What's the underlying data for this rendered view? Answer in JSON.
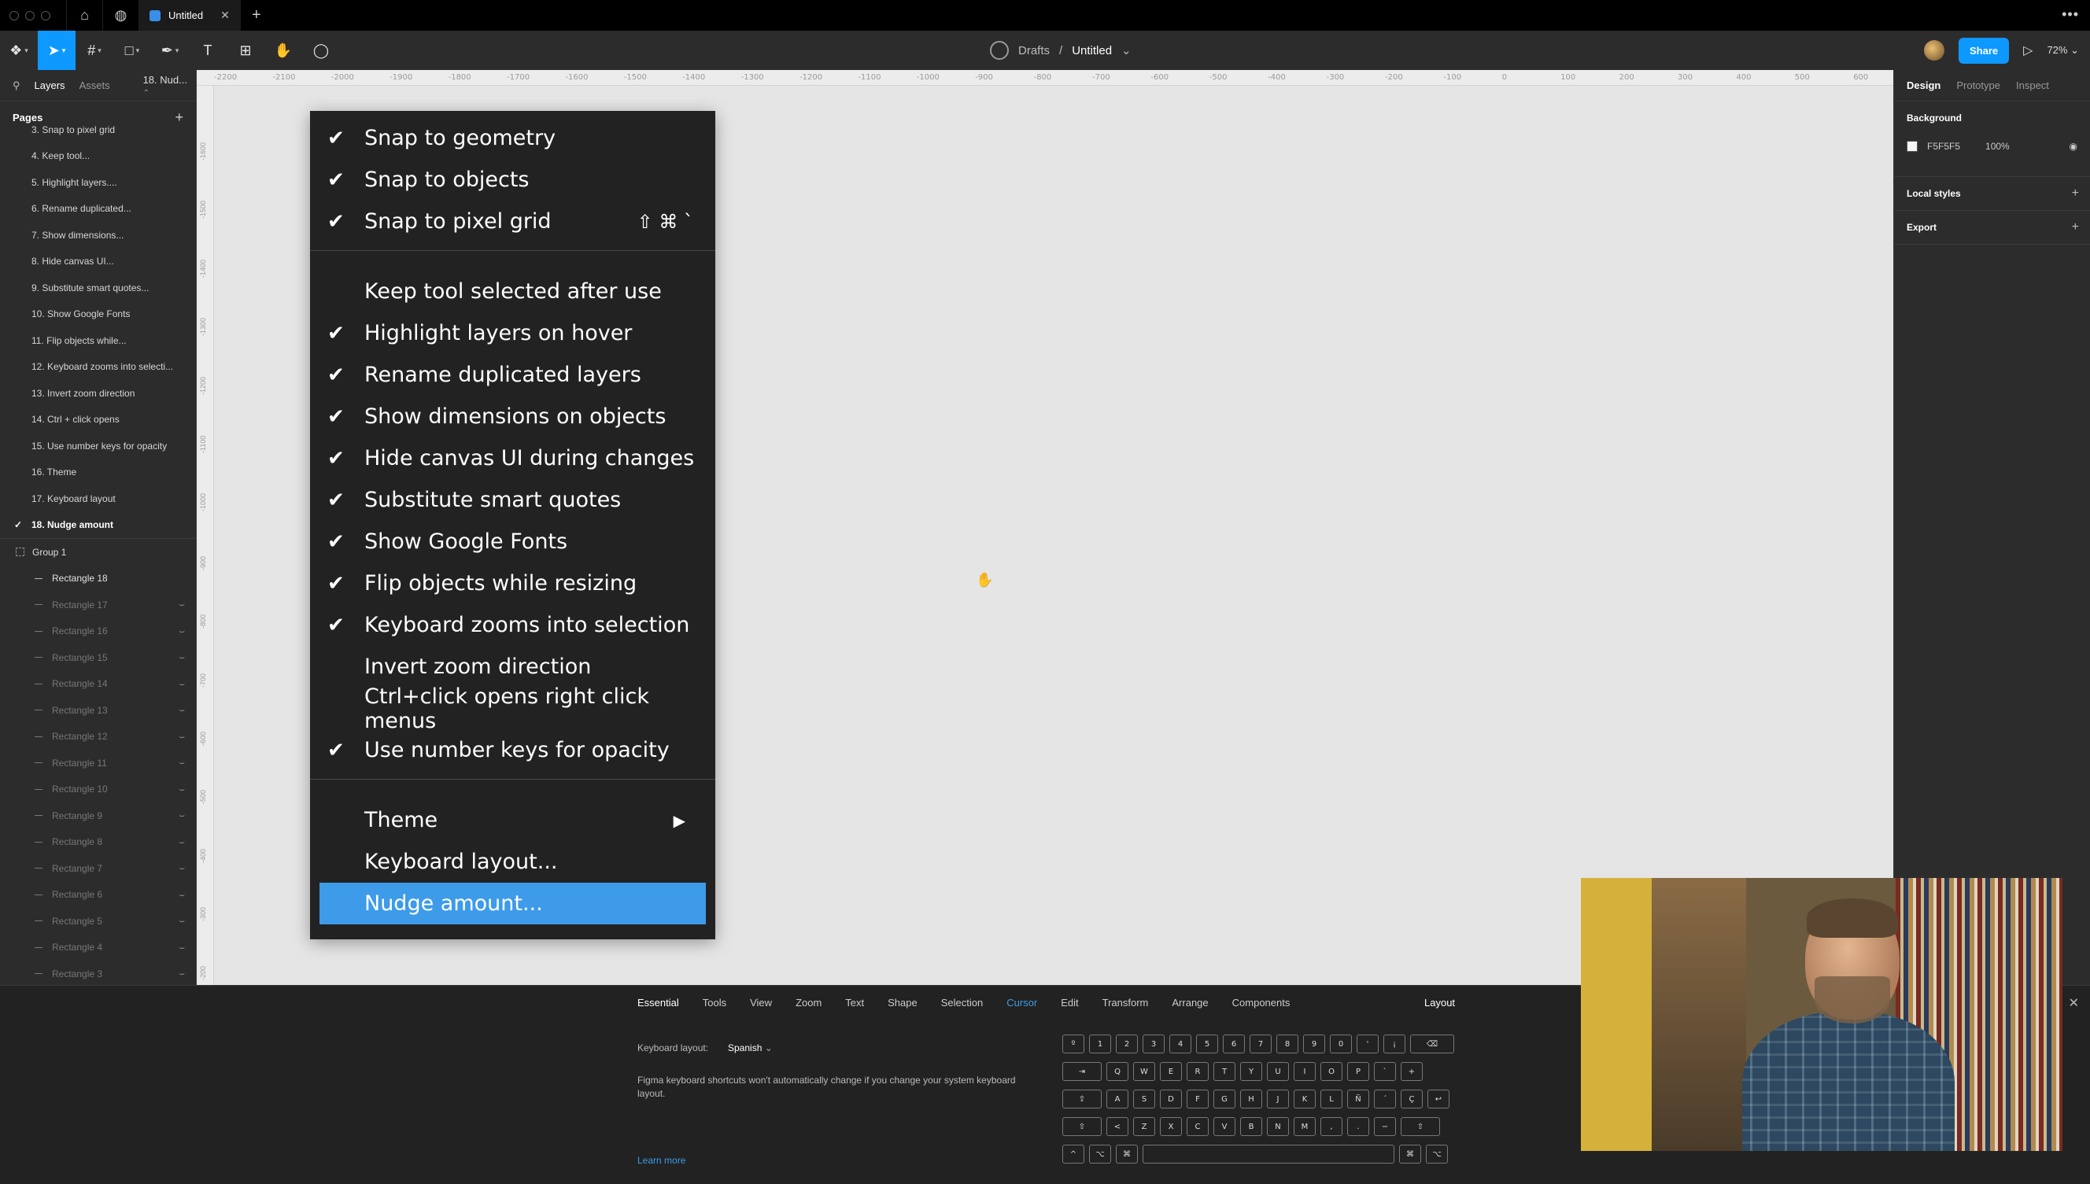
{
  "titlebar": {
    "tab_title": "Untitled"
  },
  "toolbar": {
    "breadcrumb_team": "Drafts",
    "breadcrumb_sep": "/",
    "file_name": "Untitled",
    "share_label": "Share",
    "zoom": "72%"
  },
  "left_panel": {
    "tabs": [
      "Layers",
      "Assets"
    ],
    "current_page_short": "18. Nud...",
    "pages_header": "Pages",
    "pages": [
      "3. Snap to pixel grid",
      "4. Keep tool...",
      "5. Highlight layers....",
      "6. Rename duplicated...",
      "7. Show dimensions...",
      "8. Hide canvas UI...",
      "9. Substitute smart quotes...",
      "10. Show Google Fonts",
      "11. Flip objects while...",
      "12. Keyboard zooms into selecti...",
      "13. Invert zoom direction",
      "14. Ctrl + click opens",
      "15. Use number keys for opacity",
      "16. Theme",
      "17. Keyboard layout",
      "18. Nudge amount"
    ],
    "group_name": "Group 1",
    "layers": [
      "Rectangle 18",
      "Rectangle 17",
      "Rectangle 16",
      "Rectangle 15",
      "Rectangle 14",
      "Rectangle 13",
      "Rectangle 12",
      "Rectangle 11",
      "Rectangle 10",
      "Rectangle 9",
      "Rectangle 8",
      "Rectangle 7",
      "Rectangle 6",
      "Rectangle 5",
      "Rectangle 4",
      "Rectangle 3"
    ]
  },
  "ruler": {
    "top_ticks": [
      "-2200",
      "-2100",
      "-2000",
      "-1900",
      "-1800",
      "-1700",
      "-1600",
      "-1500",
      "-1400",
      "-1300",
      "-1200",
      "-1100",
      "-1000",
      "-900",
      "-800",
      "-700",
      "-600",
      "-500",
      "-400",
      "-300",
      "-200",
      "-100",
      "0",
      "100",
      "200",
      "300",
      "400",
      "500",
      "600"
    ],
    "left_ticks": [
      "-1600",
      "-1500",
      "-1400",
      "-1300",
      "-1200",
      "-1100",
      "-1000",
      "-900",
      "-800",
      "-700",
      "-600",
      "-500",
      "-400",
      "-300",
      "-200"
    ]
  },
  "menu": {
    "group1": [
      {
        "label": "Snap to geometry",
        "checked": true
      },
      {
        "label": "Snap to objects",
        "checked": true
      },
      {
        "label": "Snap to pixel grid",
        "checked": true,
        "shortcut": "⇧ ⌘ `"
      }
    ],
    "group2": [
      {
        "label": "Keep tool selected after use",
        "checked": false
      },
      {
        "label": "Highlight layers on hover",
        "checked": true
      },
      {
        "label": "Rename duplicated layers",
        "checked": true
      },
      {
        "label": "Show dimensions on objects",
        "checked": true
      },
      {
        "label": "Hide canvas UI during changes",
        "checked": true
      },
      {
        "label": "Substitute smart quotes",
        "checked": true
      },
      {
        "label": "Show Google Fonts",
        "checked": true
      },
      {
        "label": "Flip objects while resizing",
        "checked": true
      },
      {
        "label": "Keyboard zooms into selection",
        "checked": true
      },
      {
        "label": "Invert zoom direction",
        "checked": false
      },
      {
        "label": "Ctrl+click opens right click menus",
        "checked": false
      },
      {
        "label": "Use number keys for opacity",
        "checked": true
      }
    ],
    "group3": [
      {
        "label": "Theme",
        "submenu": true
      },
      {
        "label": "Keyboard layout...",
        "submenu": false
      },
      {
        "label": "Nudge amount...",
        "submenu": false,
        "highlighted": true
      }
    ]
  },
  "right_panel": {
    "tabs": [
      "Design",
      "Prototype",
      "Inspect"
    ],
    "background_header": "Background",
    "background_hex": "F5F5F5",
    "background_opacity": "100%",
    "local_styles": "Local styles",
    "export": "Export"
  },
  "shortcuts_panel": {
    "categories": [
      "Essential",
      "Tools",
      "View",
      "Zoom",
      "Text",
      "Shape",
      "Selection",
      "Cursor",
      "Edit",
      "Transform",
      "Arrange",
      "Components"
    ],
    "layout_tab": "Layout",
    "keyboard_layout_label": "Keyboard layout:",
    "keyboard_layout_value": "Spanish",
    "note": "Figma keyboard shortcuts won't automatically change if you change your system keyboard layout.",
    "learn_more": "Learn more",
    "key_rows": [
      [
        "º",
        "1",
        "2",
        "3",
        "4",
        "5",
        "6",
        "7",
        "8",
        "9",
        "0",
        "'",
        "¡",
        "⌫"
      ],
      [
        "⇥",
        "Q",
        "W",
        "E",
        "R",
        "T",
        "Y",
        "U",
        "I",
        "O",
        "P",
        "`",
        "+"
      ],
      [
        "⇪",
        "A",
        "S",
        "D",
        "F",
        "G",
        "H",
        "J",
        "K",
        "L",
        "Ñ",
        "´",
        "Ç",
        "↩"
      ],
      [
        "⇧",
        "<",
        "Z",
        "X",
        "C",
        "V",
        "B",
        "N",
        "M",
        ",",
        ".",
        "−",
        "⇧"
      ],
      [
        "^",
        "⌥",
        "⌘",
        "",
        "⌘",
        "⌥"
      ]
    ]
  },
  "colors": {
    "accent": "#0d99ff",
    "menu_highlight": "#3d9be9",
    "canvas_bg": "#e5e5e5",
    "menu_bg": "#222222"
  }
}
